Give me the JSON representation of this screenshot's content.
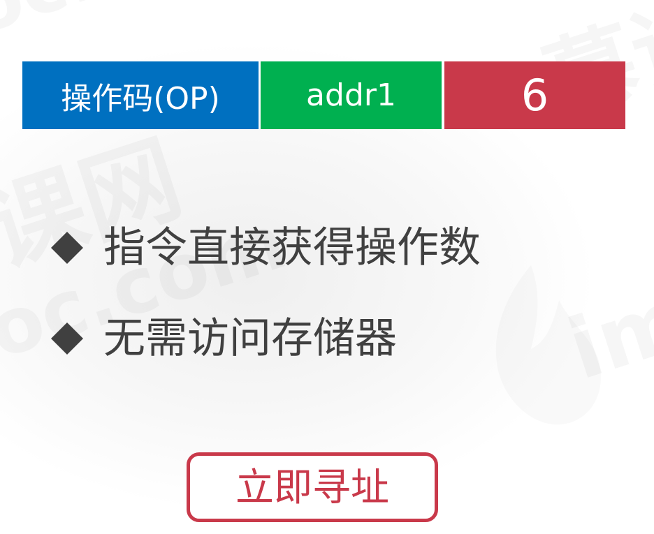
{
  "instruction_format": {
    "fields": [
      {
        "label": "操作码(OP)",
        "color": "#0070C0"
      },
      {
        "label": "addr1",
        "color": "#00B050"
      },
      {
        "label": "6",
        "color": "#C9394A"
      }
    ]
  },
  "bullets": [
    {
      "icon": "diamond-icon",
      "text": "指令直接获得操作数"
    },
    {
      "icon": "diamond-icon",
      "text": "无需访问存储器"
    }
  ],
  "addressing_mode": {
    "label": "立即寻址",
    "color": "#C9394A"
  },
  "watermark": {
    "brand_cn": "慕课网",
    "brand_en": "imooc.com"
  },
  "colors": {
    "text": "#404040",
    "bullet_icon": "#404040",
    "background": "#FFFFFF"
  }
}
